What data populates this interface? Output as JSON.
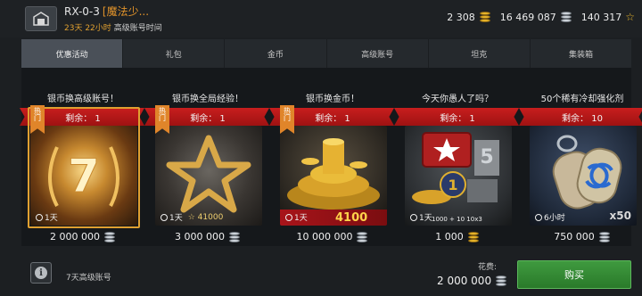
{
  "header": {
    "player_name": "RX-0-3",
    "clan_tag": "[魔法少...",
    "premium_time": "23天 22小时",
    "premium_label": "高级账号时间",
    "gold": "2 308",
    "silver": "16 469 087",
    "free_xp": "140 317"
  },
  "tabs": [
    {
      "label": "优惠活动",
      "active": true
    },
    {
      "label": "礼包"
    },
    {
      "label": "金币"
    },
    {
      "label": "高级账号"
    },
    {
      "label": "坦克"
    },
    {
      "label": "集装箱"
    }
  ],
  "offers": [
    {
      "title": "银币换高级账号！",
      "remaining": "剩余： 1",
      "hot": "热门",
      "timer": "1天",
      "price": "2 000 000",
      "currency": "silver"
    },
    {
      "title": "银币换全局经验！",
      "remaining": "剩余： 1",
      "hot": "热门",
      "timer": "1天",
      "bonus": "41000",
      "price": "3 000 000",
      "currency": "silver"
    },
    {
      "title": "银币换金币！",
      "remaining": "剩余： 1",
      "hot": "热门",
      "timer": "1天",
      "bonus": "4100",
      "price": "10 000 000",
      "currency": "silver"
    },
    {
      "title": "今天你愚人了吗？",
      "remaining": "剩余： 1",
      "timer": "1天",
      "bundle": "1000 +",
      "bundle_count": "10x3",
      "bundle_badge": "10",
      "price": "1 000",
      "currency": "gold"
    },
    {
      "title": "50个稀有冷却强化剂",
      "remaining": "剩余： 10",
      "timer": "6小时",
      "bonus": "x50",
      "price": "750 000",
      "currency": "silver"
    }
  ],
  "bottom": {
    "product_name": "7天高级账号",
    "cost_label": "花费:",
    "cost_value": "2 000 000",
    "buy_label": "购买"
  },
  "colors": {
    "accent_orange": "#e0a030",
    "ribbon_red": "#c81e1e",
    "buy_green": "#3f9a3f"
  }
}
